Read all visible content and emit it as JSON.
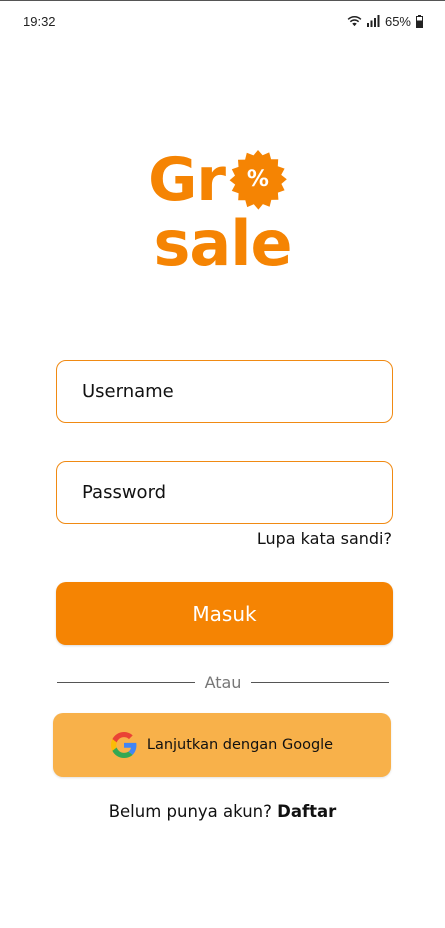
{
  "status_bar": {
    "time": "19:32",
    "battery": "65%",
    "icons": [
      "wifi-icon",
      "signal-icon",
      "battery-icon"
    ]
  },
  "logo": {
    "line1": "Gr",
    "badge_symbol": "%",
    "line2": "sale",
    "color": "#f58403"
  },
  "form": {
    "username_placeholder": "Username",
    "username_value": "",
    "password_placeholder": "Password",
    "password_value": "",
    "forgot_password": "Lupa kata sandi?",
    "login_label": "Masuk"
  },
  "divider": {
    "label": "Atau"
  },
  "google": {
    "label": "Lanjutkan dengan Google",
    "icon": "google-icon"
  },
  "register": {
    "prompt": "Belum punya akun? ",
    "link": "Daftar"
  },
  "colors": {
    "primary": "#f58403",
    "secondary": "#f8b14a",
    "border": "#f08a13"
  }
}
